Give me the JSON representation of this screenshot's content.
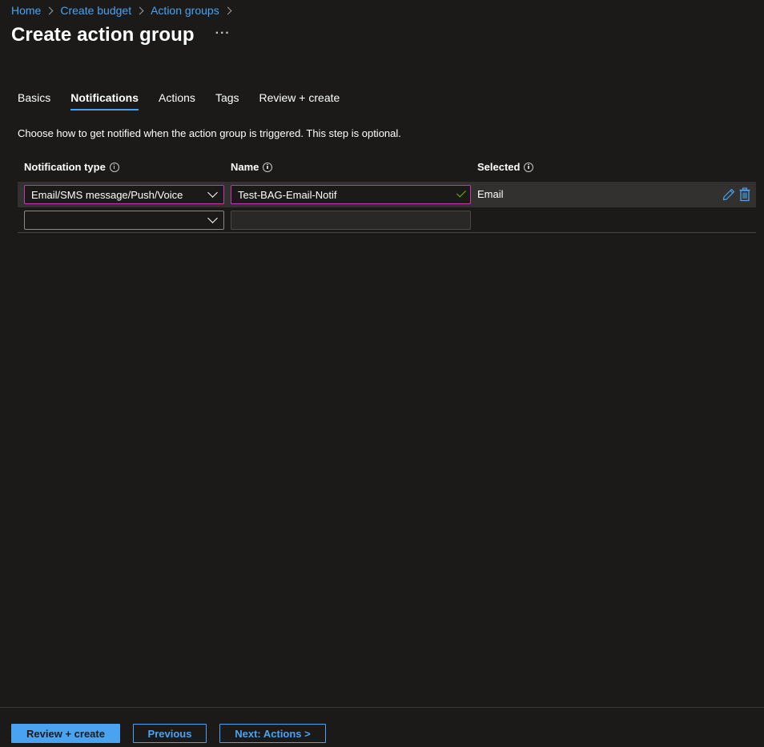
{
  "breadcrumb": {
    "items": [
      "Home",
      "Create budget",
      "Action groups"
    ]
  },
  "page": {
    "title": "Create action group",
    "more": "···"
  },
  "tabs": [
    {
      "label": "Basics",
      "active": false
    },
    {
      "label": "Notifications",
      "active": true
    },
    {
      "label": "Actions",
      "active": false
    },
    {
      "label": "Tags",
      "active": false
    },
    {
      "label": "Review + create",
      "active": false
    }
  ],
  "description": "Choose how to get notified when the action group is triggered. This step is optional.",
  "table": {
    "headers": {
      "type": "Notification type",
      "name": "Name",
      "selected": "Selected"
    },
    "rows": [
      {
        "type": "Email/SMS message/Push/Voice",
        "name": "Test-BAG-Email-Notif",
        "selected": "Email"
      },
      {
        "type": "",
        "name": "",
        "selected": ""
      }
    ]
  },
  "footer": {
    "review_create": "Review + create",
    "previous": "Previous",
    "next": "Next: Actions >"
  },
  "colors": {
    "accent": "#4aa3f0",
    "focus_border": "#c239b3",
    "valid_check": "#6bb700",
    "background": "#1b1a19"
  },
  "icons": [
    "info-icon",
    "chevron-down-icon",
    "check-icon",
    "edit-icon",
    "delete-icon"
  ]
}
